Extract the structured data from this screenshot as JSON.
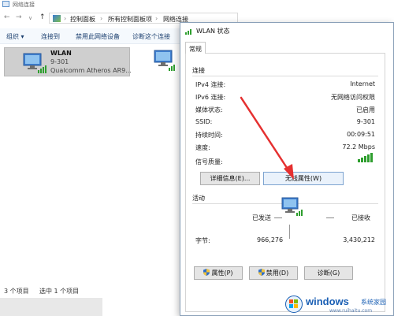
{
  "explorer": {
    "title": "网络连接",
    "nav": {
      "back": "←",
      "forward": "→",
      "dropdown": "∨",
      "up": "↑"
    },
    "breadcrumb": [
      "控制面板",
      "所有控制面板项",
      "网络连接"
    ],
    "commands": [
      "组织 ▾",
      "连接到",
      "禁用此网络设备",
      "诊断这个连接"
    ],
    "adapter": {
      "name": "WLAN",
      "network": "9-301",
      "device": "Qualcomm Atheros AR9..."
    },
    "status": {
      "item_count": "3 个项目",
      "selected": "选中 1 个项目"
    }
  },
  "dialog": {
    "title": "WLAN 状态",
    "tab": "常规",
    "connection": {
      "header": "连接",
      "rows": [
        {
          "label": "IPv4 连接:",
          "value": "Internet"
        },
        {
          "label": "IPv6 连接:",
          "value": "无网络访问权限"
        },
        {
          "label": "媒体状态:",
          "value": "已启用"
        },
        {
          "label": "SSID:",
          "value": "9-301"
        },
        {
          "label": "持续时间:",
          "value": "00:09:51"
        },
        {
          "label": "速度:",
          "value": "72.2 Mbps"
        }
      ],
      "signal_label": "信号质量:",
      "signal_level": 1.0,
      "details_button": "详细信息(E)...",
      "wireless_props_button": "无线属性(W)"
    },
    "activity": {
      "header": "活动",
      "sent_label": "已发送",
      "received_label": "已接收",
      "bytes_label": "字节:",
      "sent_value": "966,276",
      "received_value": "3,430,212"
    },
    "buttons": {
      "properties": "属性(P)",
      "disable": "禁用(D)",
      "diagnose": "诊断(G)"
    }
  },
  "watermark": {
    "brand": "windows",
    "suffix": "系统家园",
    "url": "www.ruihaitu.com"
  },
  "colors": {
    "accent": "#1a5fb4",
    "signal": "#2e9e2e",
    "arrow": "#e53030"
  }
}
